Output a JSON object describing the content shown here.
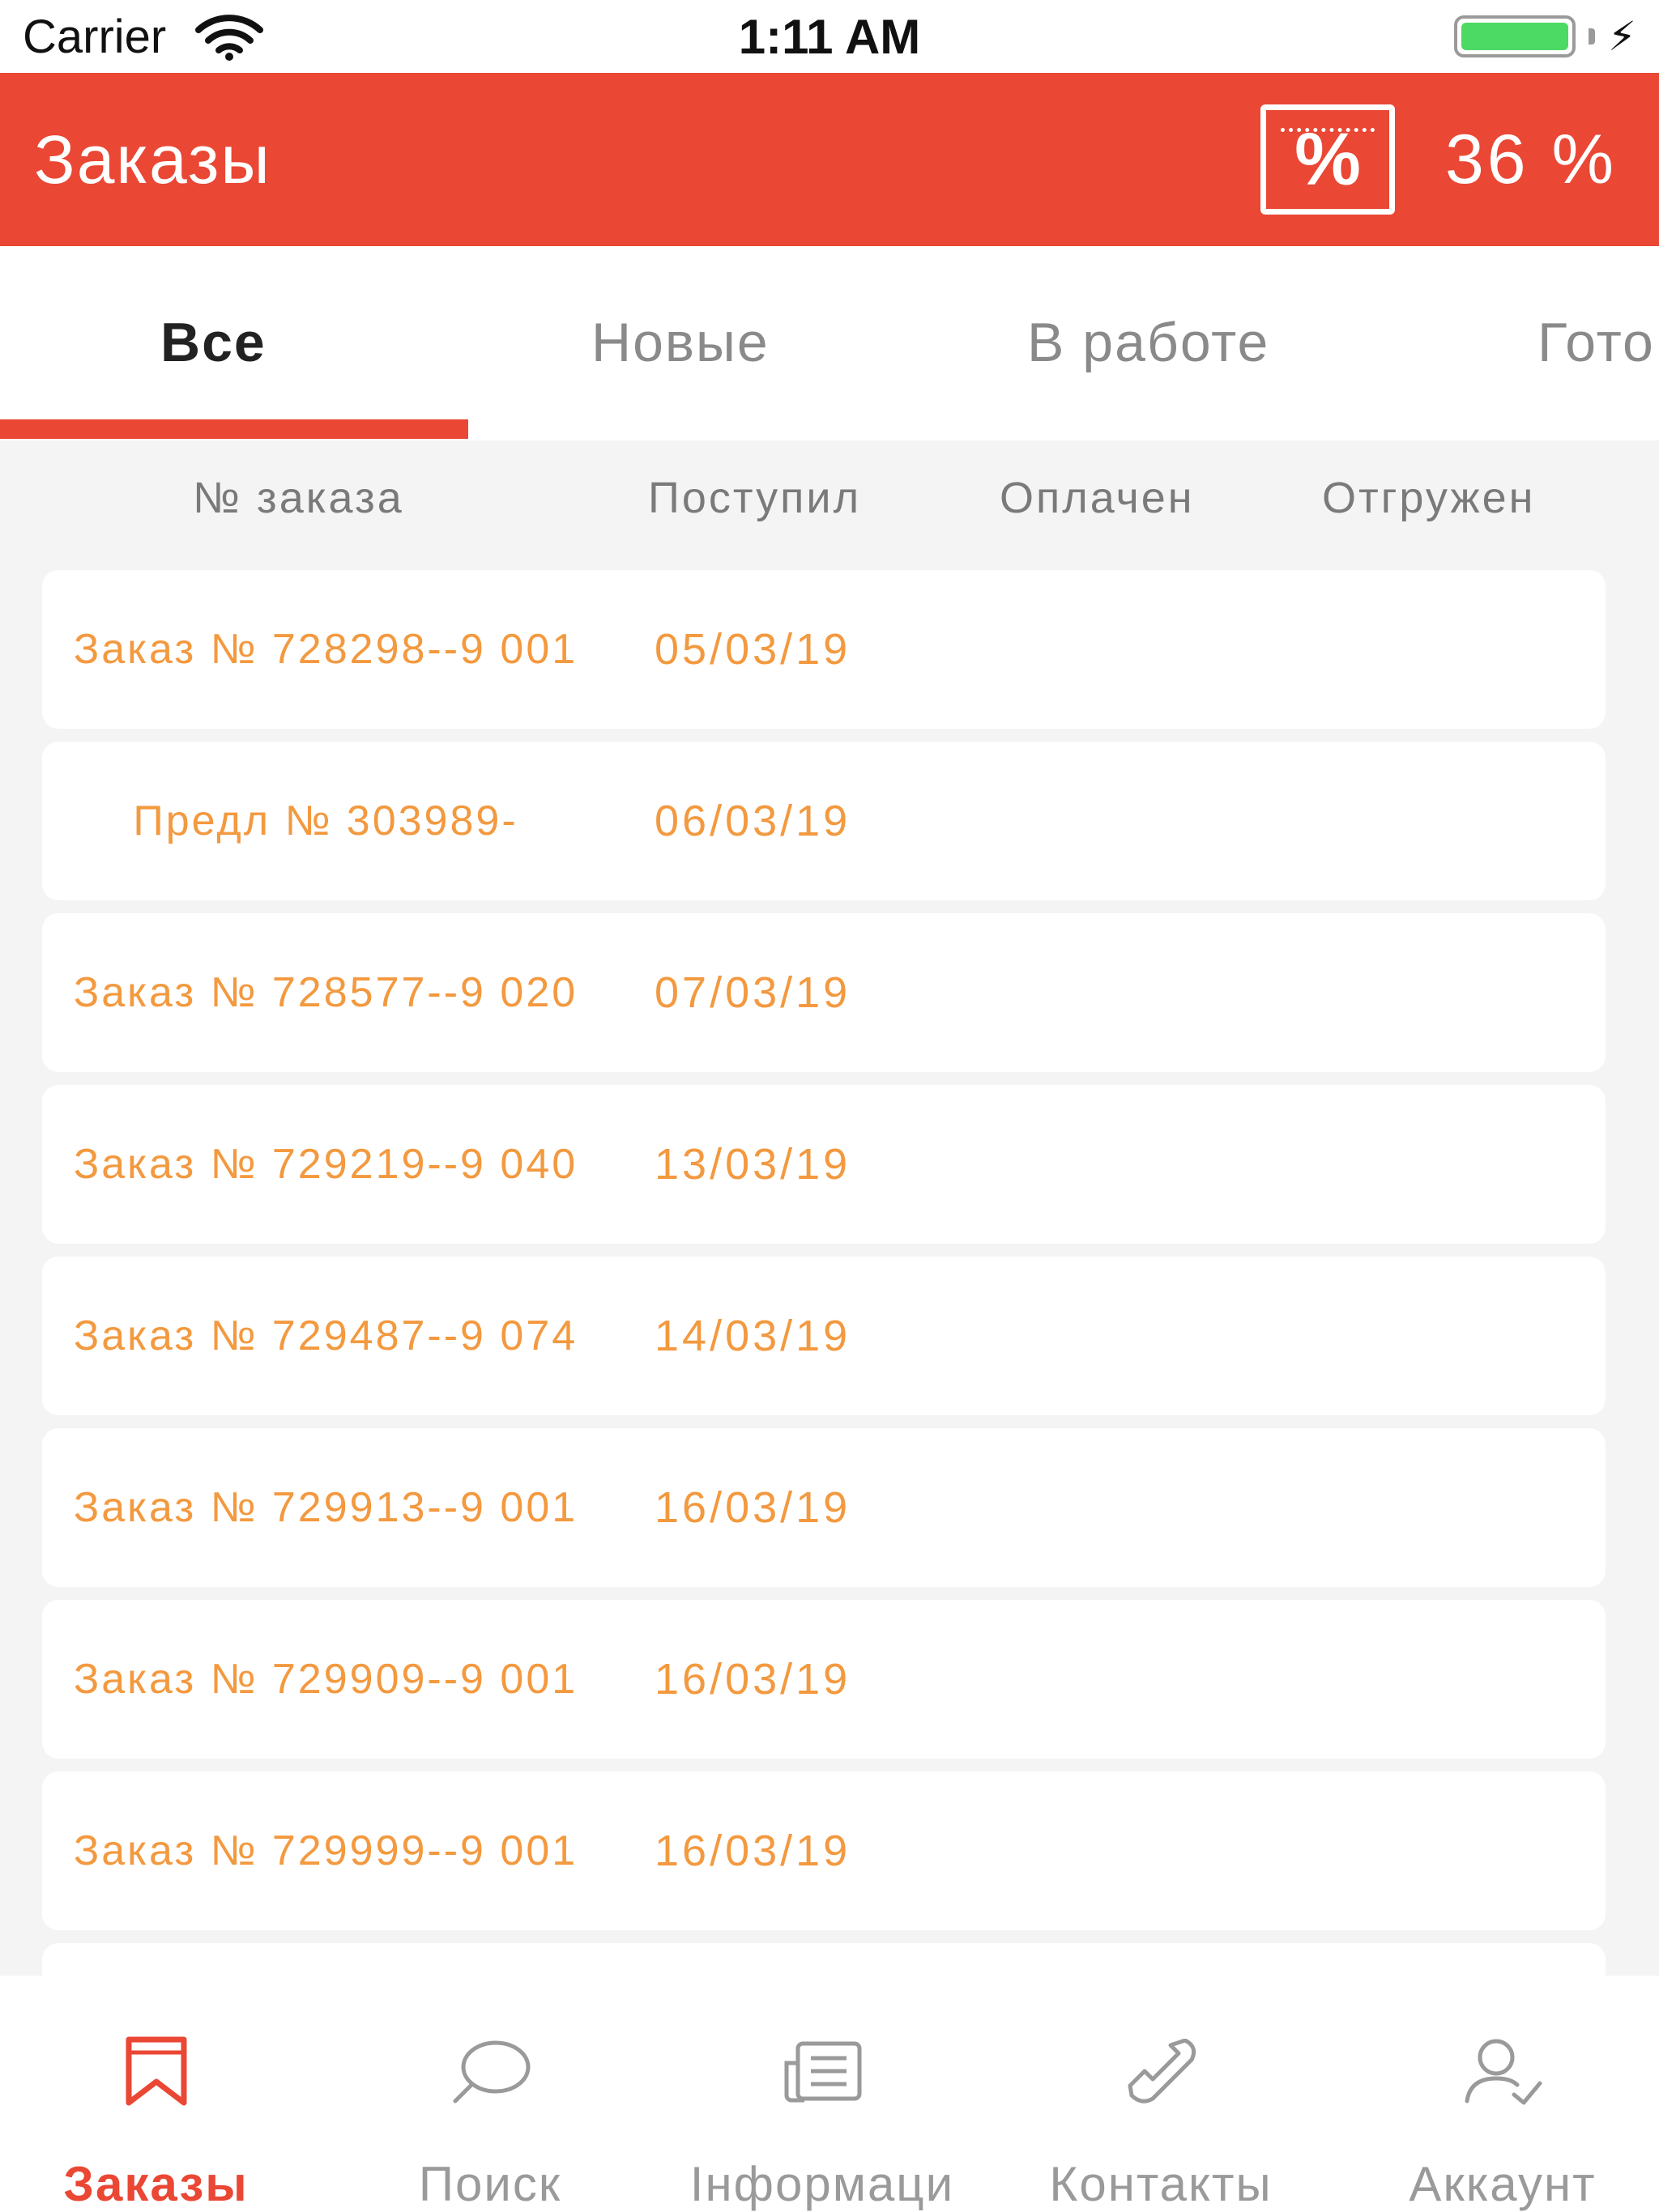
{
  "status_bar": {
    "carrier": "Carrier",
    "time": "1:11 AM",
    "battery_level": 1.0
  },
  "header": {
    "title": "Заказы",
    "discount_icon": "percent-receipt-icon",
    "discount_value": "36 %"
  },
  "tabs": [
    {
      "label": "Все",
      "active": true
    },
    {
      "label": "Новые",
      "active": false
    },
    {
      "label": "В работе",
      "active": false
    },
    {
      "label": "Гото",
      "active": false
    }
  ],
  "columns": [
    "№ заказа",
    "Поступил",
    "Оплачен",
    "Отгружен"
  ],
  "orders": [
    {
      "name": "Заказ № 728298--9 001",
      "date": "05/03/19"
    },
    {
      "name": "Предл № 303989-",
      "date": "06/03/19"
    },
    {
      "name": "Заказ № 728577--9 020",
      "date": "07/03/19"
    },
    {
      "name": "Заказ № 729219--9 040",
      "date": "13/03/19"
    },
    {
      "name": "Заказ № 729487--9 074",
      "date": "14/03/19"
    },
    {
      "name": "Заказ № 729913--9 001",
      "date": "16/03/19"
    },
    {
      "name": "Заказ № 729909--9 001",
      "date": "16/03/19"
    },
    {
      "name": "Заказ № 729999--9 001",
      "date": "16/03/19"
    },
    {
      "name": "",
      "date": ""
    }
  ],
  "tab_bar": [
    {
      "label": "Заказы",
      "icon": "bookmark-icon",
      "active": true
    },
    {
      "label": "Поиск",
      "icon": "search-icon",
      "active": false
    },
    {
      "label": "Інформаци",
      "icon": "document-icon",
      "active": false
    },
    {
      "label": "Контакты",
      "icon": "phone-icon",
      "active": false
    },
    {
      "label": "Аккаунт",
      "icon": "user-check-icon",
      "active": false
    }
  ],
  "colors": {
    "accent": "#ea4734",
    "order_text": "#f3993f",
    "inactive": "#9a9a9a"
  }
}
